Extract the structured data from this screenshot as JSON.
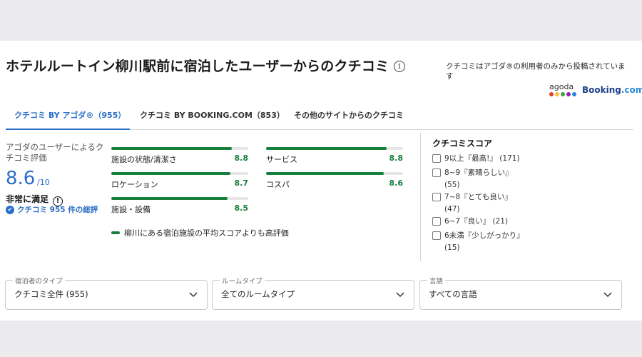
{
  "header": {
    "title": "ホテルルートイン柳川駅前に宿泊したユーザーからのクチコミ",
    "info_icon": "i",
    "notice": "クチコミはアゴダ®の利用者のみから投稿されています",
    "logos": {
      "agoda": "agoda",
      "booking_main": "Booking",
      "booking_suffix": ".com"
    }
  },
  "colors": {
    "accent": "#2a6ec7",
    "good": "#17803d",
    "agoda_dots": [
      "#e53935",
      "#fbc02d",
      "#43a047",
      "#8e24aa",
      "#1e88e5"
    ]
  },
  "tabs": [
    {
      "label": "クチコミ BY アゴダ®（955）",
      "active": true
    },
    {
      "label": "クチコミ BY BOOKING.COM（853）",
      "active": false
    },
    {
      "label": "その他のサイトからのクチコミ",
      "active": false
    }
  ],
  "summary": {
    "label": "アゴダのユーザーによるクチコミ評価",
    "score": "8.6",
    "score_max": "/10",
    "verdict": "非常に満足",
    "verdict_icon": "!",
    "total": "クチコミ 955 件の総評"
  },
  "categories": [
    {
      "label": "施設の状態/清潔さ",
      "value": "8.8",
      "fill": 0.88
    },
    {
      "label": "サービス",
      "value": "8.8",
      "fill": 0.88
    },
    {
      "label": "ロケーション",
      "value": "8.7",
      "fill": 0.87
    },
    {
      "label": "コスパ",
      "value": "8.6",
      "fill": 0.86
    },
    {
      "label": "施設・設備",
      "value": "8.5",
      "fill": 0.85
    }
  ],
  "comparison_legend": "柳川にある宿泊施設の平均スコアよりも高評価",
  "score_filter": {
    "title": "クチコミスコア",
    "items": [
      {
        "label": "9以上『最高!』",
        "count": "(171)"
      },
      {
        "label": "8~9『素晴らしい』",
        "count": "(55)"
      },
      {
        "label": "7~8『とても良い』",
        "count": "(47)"
      },
      {
        "label": "6~7『良い』",
        "count": "(21)"
      },
      {
        "label": "6未満『少しがっかり』",
        "count": "(15)"
      }
    ]
  },
  "selects": [
    {
      "label": "宿泊者のタイプ",
      "value": "クチコミ全件 (955)"
    },
    {
      "label": "ルームタイプ",
      "value": "全てのルームタイプ"
    },
    {
      "label": "言語",
      "value": "すべての言語"
    }
  ]
}
